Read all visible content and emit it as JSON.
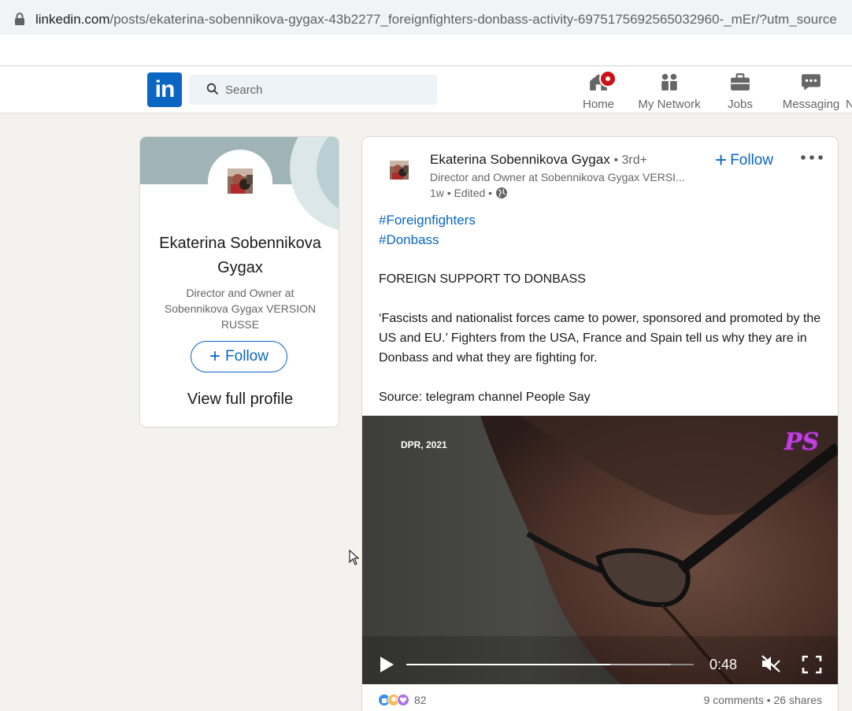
{
  "browser": {
    "url_host": "linkedin.com",
    "url_path": "/posts/ekaterina-sobennikova-gygax-43b2277_foreignfighters-donbass-activity-6975175692565032960-_mEr/?utm_source"
  },
  "nav": {
    "logo_text": "in",
    "search_placeholder": "Search",
    "items": [
      {
        "label": "Home",
        "icon": "home-icon"
      },
      {
        "label": "My Network",
        "icon": "network-icon"
      },
      {
        "label": "Jobs",
        "icon": "briefcase-icon"
      },
      {
        "label": "Messaging",
        "icon": "messaging-icon"
      },
      {
        "label": "N",
        "icon": ""
      }
    ],
    "accent_color": "#0a66c2",
    "badge_color": "#cc1016"
  },
  "profile_card": {
    "name": "Ekaterina Sobennikova Gygax",
    "headline": "Director and Owner at Sobennikova Gygax VERSION RUSSE",
    "follow_label": "Follow",
    "view_profile_label": "View full profile"
  },
  "post": {
    "author": "Ekaterina Sobennikova Gygax",
    "degree": "• 3rd+",
    "headline": "Director and Owner at Sobennikova Gygax VERSI...",
    "meta": "1w • Edited •",
    "follow_label": "Follow",
    "hashtags": [
      "#Foreignfighters",
      "#Donbass"
    ],
    "title": "FOREIGN SUPPORT TO DONBASS",
    "paragraph": "‘Fascists and nationalist forces came to power, sponsored and promoted by the US and EU.’ Fighters from the USA, France and Spain tell us why they are in Donbass and what they are fighting for.",
    "source": "Source: telegram channel People Say",
    "video": {
      "overlay_text": "DPR, 2021",
      "logo_text": "PS",
      "time": "0:48",
      "progress_percent": 71,
      "buffered_percent": 92,
      "muted": true
    },
    "reactions_count": "82",
    "social_counts": "9 comments • 26 shares"
  }
}
